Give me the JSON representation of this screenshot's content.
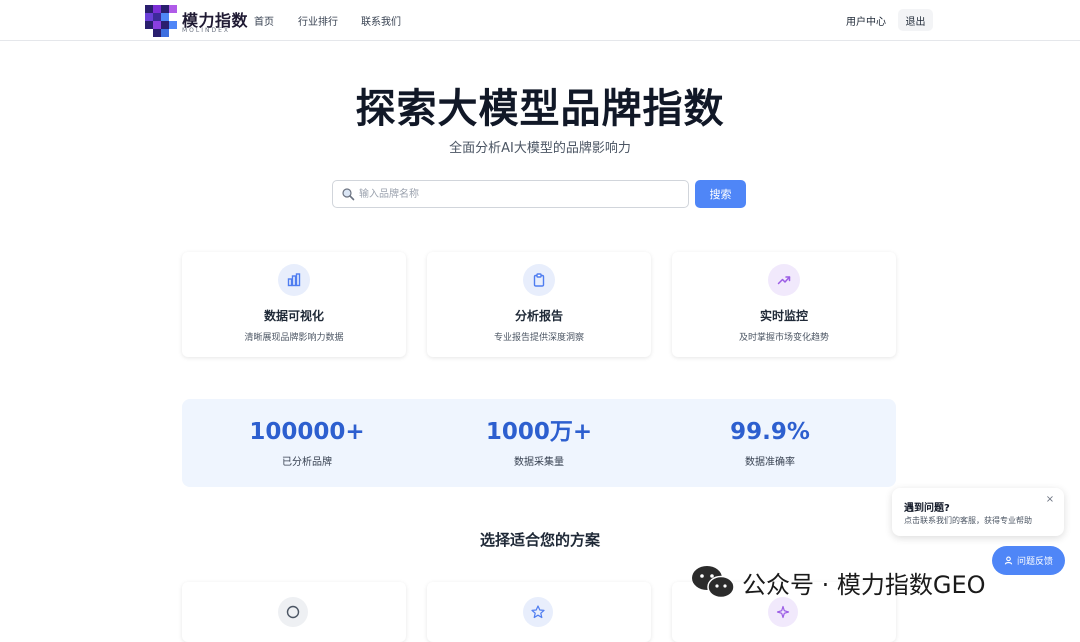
{
  "header": {
    "logo_text": "模力指数",
    "logo_sub": "MOLINDEX",
    "nav": [
      {
        "label": "首页"
      },
      {
        "label": "行业排行"
      },
      {
        "label": "联系我们"
      }
    ],
    "user_center": "用户中心",
    "logout": "退出"
  },
  "hero": {
    "title": "探索大模型品牌指数",
    "subtitle": "全面分析AI大模型的品牌影响力",
    "search_placeholder": "输入品牌名称",
    "search_button": "搜索"
  },
  "features": [
    {
      "title": "数据可视化",
      "desc": "清晰展现品牌影响力数据",
      "icon": "bar-chart-icon",
      "color": "#4f7df0"
    },
    {
      "title": "分析报告",
      "desc": "专业报告提供深度洞察",
      "icon": "clipboard-icon",
      "color": "#4f7df0"
    },
    {
      "title": "实时监控",
      "desc": "及时掌握市场变化趋势",
      "icon": "trending-up-icon",
      "color": "#9b5de5"
    }
  ],
  "stats": [
    {
      "value": "100000+",
      "label": "已分析品牌"
    },
    {
      "value": "1000万+",
      "label": "数据采集量"
    },
    {
      "value": "99.9%",
      "label": "数据准确率"
    }
  ],
  "plans": {
    "title": "选择适合您的方案",
    "icons": [
      "circle-icon",
      "star-icon",
      "sparkle-icon"
    ]
  },
  "help": {
    "title": "遇到问题?",
    "desc": "点击联系我们的客服，获得专业帮助",
    "close": "×",
    "feedback": "问题反馈"
  },
  "watermark": {
    "text": "公众号 · 模力指数GEO"
  },
  "colors": {
    "primary": "#4f86f7",
    "stat_value": "#2d5fcf",
    "stats_bg": "#eff5fe",
    "purple": "#9b5de5"
  }
}
